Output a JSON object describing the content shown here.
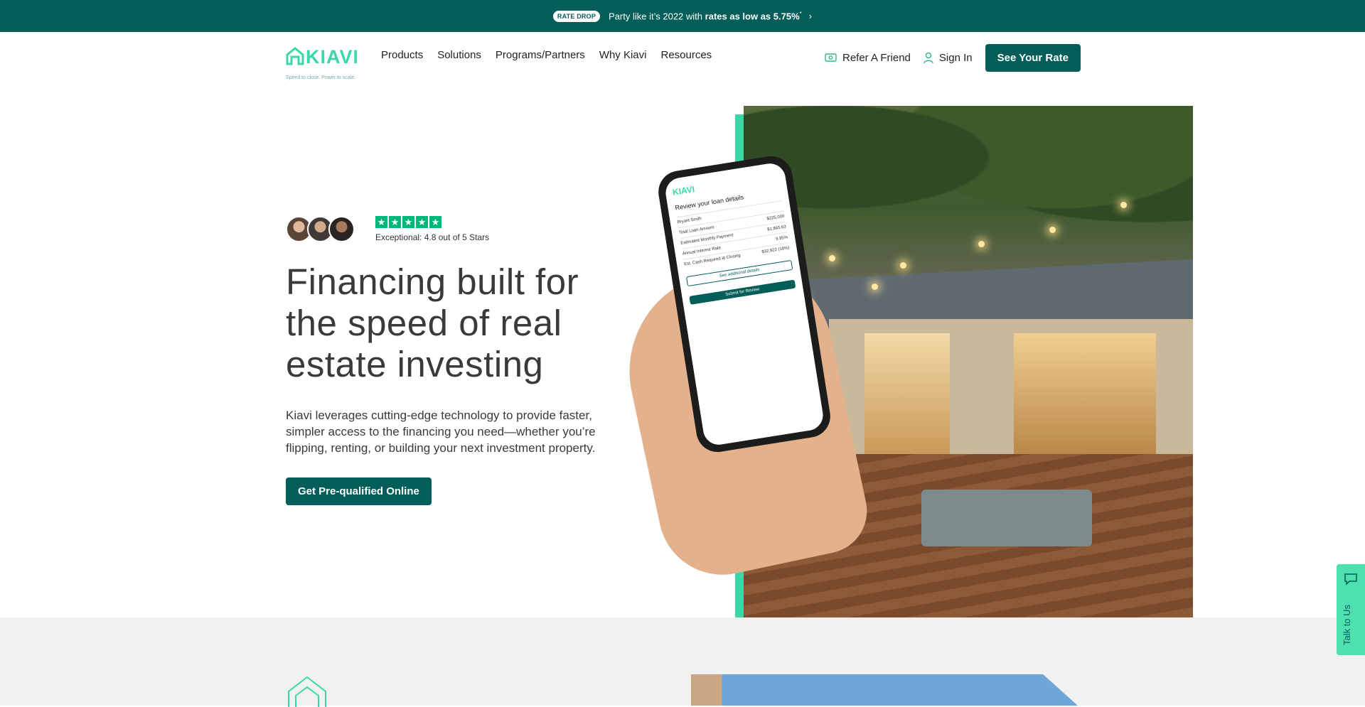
{
  "banner": {
    "pill": "RATE DROP",
    "text_prefix": "Party like it’s 2022 with",
    "text_bold": "rates as low as 5.75%",
    "sup": "*",
    "chevron_icon": "chevron-right-icon"
  },
  "nav": {
    "logo_text": "KIAVI",
    "logo_tagline": "Speed to close. Power to scale.",
    "links": [
      "Products",
      "Solutions",
      "Programs/Partners",
      "Why Kiavi",
      "Resources"
    ],
    "refer": "Refer A Friend",
    "signin": "Sign In",
    "cta": "See Your Rate"
  },
  "hero": {
    "rating_text": "Exceptional: 4.8 out of 5 Stars",
    "rating_value": 4.8,
    "rating_max": 5,
    "title": "Financing built for the speed of real estate investing",
    "description": "Kiavi leverages cutting-edge technology to provide faster, simpler access to the financing you need—whether you’re flipping, renting, or building your next investment property.",
    "cta": "Get Pre-qualified Online"
  },
  "phone": {
    "logo": "KIAVI",
    "title": "Review your loan details",
    "rows": [
      {
        "label": "Bryant Smith",
        "value": ""
      },
      {
        "label": "Total Loan Amount",
        "value": "$225,000"
      },
      {
        "label": "Estimated Monthly Payment",
        "value": "$1,865.63"
      },
      {
        "label": "Annual Interest Rate",
        "value": "9.95%"
      },
      {
        "label": "Est. Cash Required at Closing",
        "value": "$32,922 (18%)"
      }
    ],
    "button_secondary": "See additional details",
    "button_primary": "Submit for Review"
  },
  "talk": {
    "label": "Talk to Us"
  },
  "colors": {
    "brand": "#035d59",
    "accent": "#3dd6a8",
    "star": "#00b67a"
  }
}
